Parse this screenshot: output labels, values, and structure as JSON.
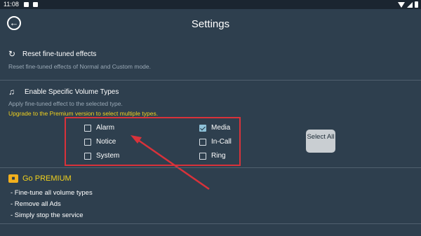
{
  "status_bar": {
    "time": "11:08"
  },
  "header": {
    "title": "Settings"
  },
  "reset": {
    "title": "Reset fine-tuned effects",
    "desc": "Reset fine-tuned effects of Normal and Custom mode."
  },
  "volume_types": {
    "title": "Enable Specific Volume Types",
    "desc": "Apply fine-tuned effect to the selected type.",
    "upgrade": "Upgrade to the Premium version to select multiple types.",
    "items": [
      {
        "label": "Alarm",
        "checked": false
      },
      {
        "label": "Media",
        "checked": true
      },
      {
        "label": "Notice",
        "checked": false
      },
      {
        "label": "In-Call",
        "checked": false
      },
      {
        "label": "System",
        "checked": false
      },
      {
        "label": "Ring",
        "checked": false
      }
    ],
    "select_all": "Select All"
  },
  "premium": {
    "title": "Go PREMIUM",
    "features": [
      "- Fine-tune all volume types",
      "- Remove all Ads",
      "- Simply stop the service"
    ]
  },
  "colors": {
    "background": "#2e3f4e",
    "accent_yellow": "#f2d21d",
    "annotation_red": "#d9323a",
    "checkbox_checked": "#8ec1d8"
  }
}
